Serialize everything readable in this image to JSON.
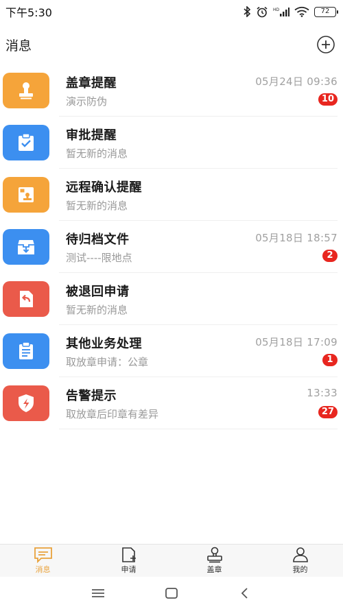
{
  "status_bar": {
    "time": "下午5:30",
    "battery": "72"
  },
  "header": {
    "title": "消息",
    "add_icon": "plus-circle-icon"
  },
  "messages": [
    {
      "title": "盖章提醒",
      "subtitle": "演示防伪",
      "time": "05月24日 09:36",
      "badge": "10",
      "icon": "stamp-icon",
      "color": "#f5a43a"
    },
    {
      "title": "审批提醒",
      "subtitle": "暂无新的消息",
      "time": "",
      "badge": "",
      "icon": "clipboard-check-icon",
      "color": "#3c8ff0"
    },
    {
      "title": "远程确认提醒",
      "subtitle": "暂无新的消息",
      "time": "",
      "badge": "",
      "icon": "remote-confirm-icon",
      "color": "#f5a43a"
    },
    {
      "title": "待归档文件",
      "subtitle": "测试----限地点",
      "time": "05月18日 18:57",
      "badge": "2",
      "icon": "archive-box-icon",
      "color": "#3c8ff0"
    },
    {
      "title": "被退回申请",
      "subtitle": "暂无新的消息",
      "time": "",
      "badge": "",
      "icon": "return-document-icon",
      "color": "#ea5a4a"
    },
    {
      "title": "其他业务处理",
      "subtitle": "取放章申请：公章",
      "time": "05月18日 17:09",
      "badge": "1",
      "icon": "clipboard-list-icon",
      "color": "#3c8ff0"
    },
    {
      "title": "告警提示",
      "subtitle": "取放章后印章有差异",
      "time": "13:33",
      "badge": "27",
      "icon": "shield-alert-icon",
      "color": "#ea5a4a"
    }
  ],
  "bottom_nav": [
    {
      "label": "消息",
      "icon": "message-icon",
      "active": true
    },
    {
      "label": "申请",
      "icon": "apply-document-icon",
      "active": false
    },
    {
      "label": "盖章",
      "icon": "stamp-outline-icon",
      "active": false
    },
    {
      "label": "我的",
      "icon": "user-icon",
      "active": false
    }
  ],
  "colors": {
    "accent": "#e9a23b",
    "badge": "#e8261f",
    "orange": "#f5a43a",
    "blue": "#3c8ff0",
    "red": "#ea5a4a"
  }
}
